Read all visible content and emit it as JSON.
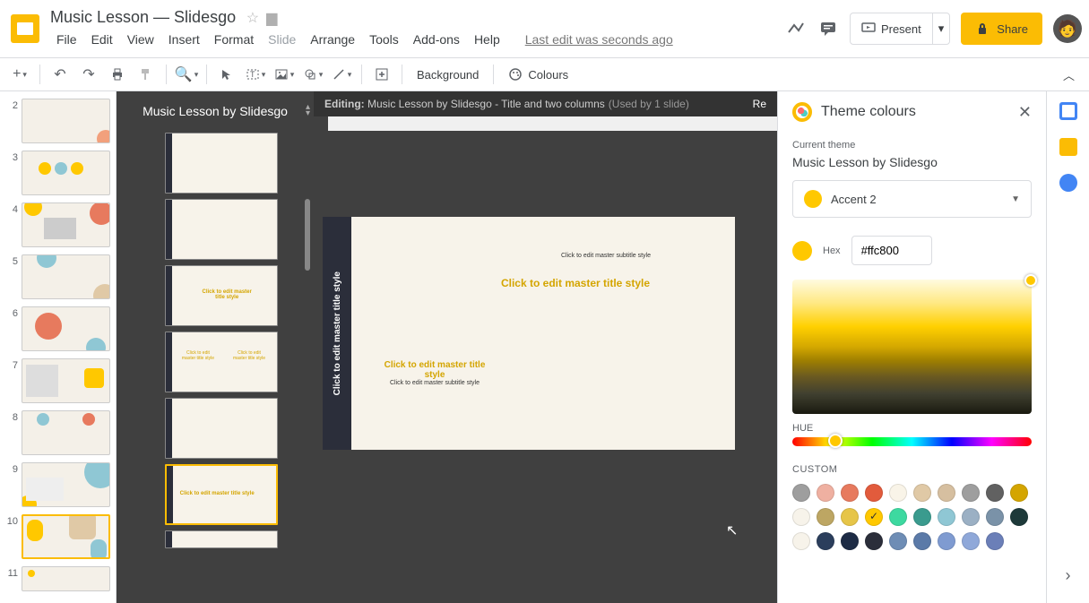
{
  "header": {
    "doc_title": "Music Lesson — Slidesgo",
    "last_edit": "Last edit was seconds ago",
    "present": "Present",
    "share": "Share"
  },
  "menu": {
    "file": "File",
    "edit": "Edit",
    "view": "View",
    "insert": "Insert",
    "format": "Format",
    "slide": "Slide",
    "arrange": "Arrange",
    "tools": "Tools",
    "addons": "Add-ons",
    "help": "Help"
  },
  "toolbar": {
    "background": "Background",
    "colours": "Colours"
  },
  "master": {
    "title": "Music Lesson by Slidesgo"
  },
  "editbar": {
    "prefix": "Editing: ",
    "name": "Music Lesson by Slidesgo - Title and two columns",
    "usage": "(Used by 1 slide)",
    "rename": "Re"
  },
  "canvas": {
    "vtitle": "Click to edit master title style",
    "sub": "Click to edit master subtitle style",
    "title": "Click to edit master title style",
    "t2a": "Click to edit master title style",
    "t2b": "Click to edit master subtitle style"
  },
  "theme": {
    "heading": "Theme colours",
    "current_label": "Current theme",
    "current_name": "Music Lesson by Slidesgo",
    "selected_color": "Accent 2",
    "hex_label": "Hex",
    "hex_value": "#ffc800",
    "hue_label": "HUE",
    "custom_label": "CUSTOM",
    "swatches_row1": [
      "#9e9e9e",
      "#efb0a1",
      "#e77a5e",
      "#e25b3c",
      "#f9f4e8",
      "#e0c9a6",
      "#d6bfa0",
      "#9e9e9e",
      "#616161"
    ],
    "swatches_row2": [
      "#d4a500",
      "#f7f3ea",
      "#bda663",
      "#e6c548",
      "#ffc800",
      "#3dd9a0",
      "#3a9b8e",
      "#8fc7d4",
      "#9bb0c4",
      "#7a92a8"
    ],
    "swatches_row3": [
      "#1e3a3a",
      "#f7f3ea",
      "#2b3e5c",
      "#1d2b45",
      "#2b2e3a",
      "#6e8db5",
      "#5b7aa8",
      "#7f9bd1",
      "#8fa8d9",
      "#6b7fb8"
    ]
  },
  "slides": {
    "nums": [
      "2",
      "3",
      "4",
      "5",
      "6",
      "7",
      "8",
      "9",
      "10",
      "11"
    ]
  }
}
